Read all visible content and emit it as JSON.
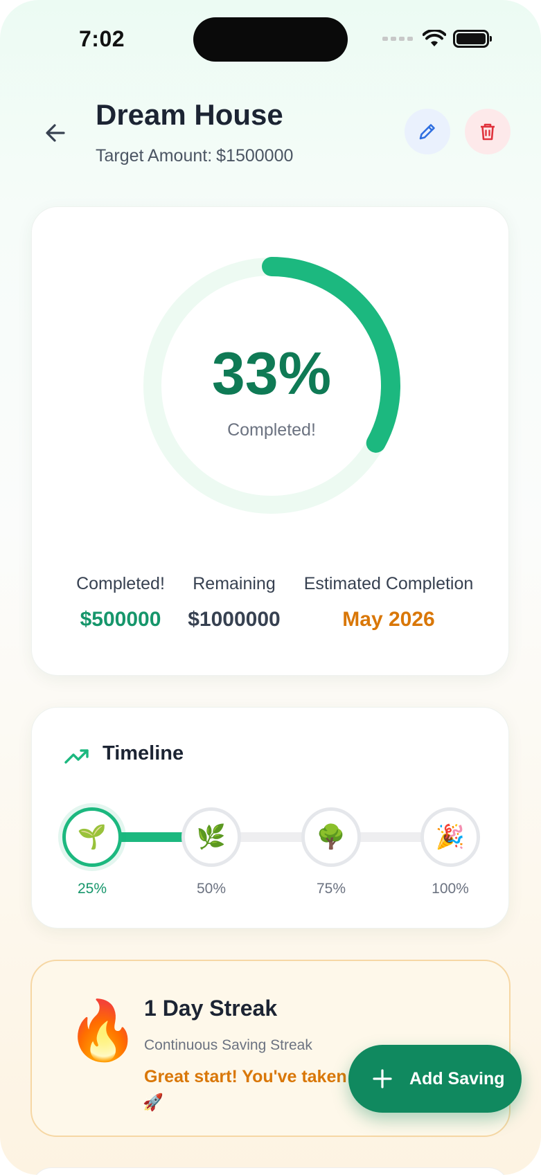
{
  "status_bar": {
    "time": "7:02"
  },
  "header": {
    "title": "Dream House",
    "target_label": "Target Amount:",
    "target_value": "$1500000"
  },
  "progress": {
    "percent_text": "33%",
    "percent_value": 0.33,
    "percent_caption": "Completed!",
    "colors": {
      "arc": "#1cb87f",
      "track": "#edfaf2",
      "percent": "#0f7a55"
    },
    "stats": [
      {
        "label": "Completed!",
        "value": "$500000"
      },
      {
        "label": "Remaining",
        "value": "$1000000"
      },
      {
        "label": "Estimated Completion",
        "value": "May 2026"
      }
    ]
  },
  "timeline": {
    "title": "Timeline",
    "icon": "trending-up-icon",
    "fill_fraction": 0.25,
    "milestones": [
      {
        "emoji": "🌱",
        "label": "25%",
        "done": true
      },
      {
        "emoji": "🌿",
        "label": "50%",
        "done": false
      },
      {
        "emoji": "🌳",
        "label": "75%",
        "done": false
      },
      {
        "emoji": "🎉",
        "label": "100%",
        "done": false
      }
    ]
  },
  "streak": {
    "emoji": "🔥",
    "title": "1 Day Streak",
    "subtitle": "Continuous Saving Streak",
    "message": "Great start! You've taken t",
    "message_emoji": "🚀"
  },
  "fab": {
    "label": "Add Saving",
    "icon": "plus-icon"
  }
}
